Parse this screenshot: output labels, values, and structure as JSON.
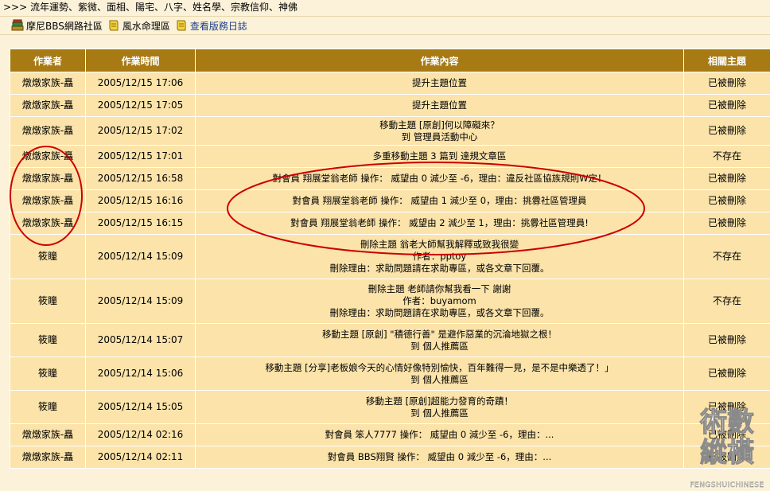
{
  "topnav": {
    "text": ">>> 流年運勢、紫微、面相、陽宅、八字、姓名學、宗教信仰、神佛"
  },
  "breadcrumb": [
    {
      "label": "摩尼BBS網路社區",
      "icon": "books-icon"
    },
    {
      "label": "風水命理區",
      "icon": "scroll-icon"
    },
    {
      "label": "查看版務日誌",
      "icon": "notepad-icon"
    }
  ],
  "table": {
    "headers": [
      "作業者",
      "作業時間",
      "作業內容",
      "相關主題"
    ],
    "rows": [
      {
        "operator": "燉燉家族-矗",
        "time": "2005/12/15 17:06",
        "content": [
          "提升主題位置"
        ],
        "status": "已被刪除"
      },
      {
        "operator": "燉燉家族-矗",
        "time": "2005/12/15 17:05",
        "content": [
          "提升主題位置"
        ],
        "status": "已被刪除"
      },
      {
        "operator": "燉燉家族-矗",
        "time": "2005/12/15 17:02",
        "content": [
          "移動主題 [原創]何以障礙來？",
          "到 管理員活動中心"
        ],
        "status": "已被刪除"
      },
      {
        "operator": "燉燉家族-矗",
        "time": "2005/12/15 17:01",
        "content": [
          "多重移動主題 3 篇到 達規文章區"
        ],
        "status": "不存在"
      },
      {
        "operator": "燉燉家族-矗",
        "time": "2005/12/15 16:58",
        "content": [
          "對會員 翔展堂翁老師 操作： 威望由 0 減少至 -6，理由：違反社區協族規則W定！"
        ],
        "status": "已被刪除"
      },
      {
        "operator": "燉燉家族-矗",
        "time": "2005/12/15 16:16",
        "content": [
          "對會員 翔展堂翁老師 操作： 威望由 1 減少至 0，理由：挑釁社區管理員"
        ],
        "status": "已被刪除"
      },
      {
        "operator": "燉燉家族-矗",
        "time": "2005/12/15 16:15",
        "content": [
          "對會員 翔展堂翁老師 操作： 威望由 2 減少至 1，理由：挑釁社區管理員!"
        ],
        "status": "已被刪除"
      },
      {
        "operator": "筱瞳",
        "time": "2005/12/14 15:09",
        "content": [
          "刪除主題 翁老大師幫我解釋或致我很變",
          "作者：pptoy",
          "刪除理由：求助問題請在求助專區，或各文章下回覆。"
        ],
        "status": "不存在"
      },
      {
        "operator": "筱瞳",
        "time": "2005/12/14 15:09",
        "content": [
          "刪除主題 老師請你幫我看一下 謝謝",
          "作者：buyamom",
          "刪除理由：求助問題請在求助專區，或各文章下回覆。"
        ],
        "status": "不存在"
      },
      {
        "operator": "筱瞳",
        "time": "2005/12/14 15:07",
        "content": [
          "移動主題 [原創] \"積德行善\" 是避作惡業的沉淪地獄之根！",
          "到 個人推薦區"
        ],
        "status": "已被刪除"
      },
      {
        "operator": "筱瞳",
        "time": "2005/12/14 15:06",
        "content": [
          "移動主題 [分享]老板娘今天的心情好像特別愉快，百年難得一見，是不是中樂透了！」",
          "到 個人推薦區"
        ],
        "status": "已被刪除"
      },
      {
        "operator": "筱瞳",
        "time": "2005/12/14 15:05",
        "content": [
          "移動主題 [原創]超能力發育的奇蹟！",
          "到 個人推薦區"
        ],
        "status": "已被刪除"
      },
      {
        "operator": "燉燉家族-矗",
        "time": "2005/12/14 02:16",
        "content": [
          "對會員 笨人7777 操作： 威望由 0 減少至 -6，理由：..."
        ],
        "status": "已被刪除"
      },
      {
        "operator": "燉燉家族-矗",
        "time": "2005/12/14 02:11",
        "content": [
          "對會員 BBS翔賢 操作： 威望由 0 減少至 -6，理由：..."
        ],
        "status": "已被刪除"
      }
    ]
  },
  "watermark": {
    "chars": [
      "術",
      "數",
      "縱",
      "橫"
    ],
    "site": "FENGSHUICHINESE"
  },
  "colors": {
    "header_bg": "#a77a14",
    "row_bg": "#fbe3aa",
    "page_bg": "#fbf2d9",
    "annotation": "#cc0000",
    "link": "#1b3e8a"
  }
}
